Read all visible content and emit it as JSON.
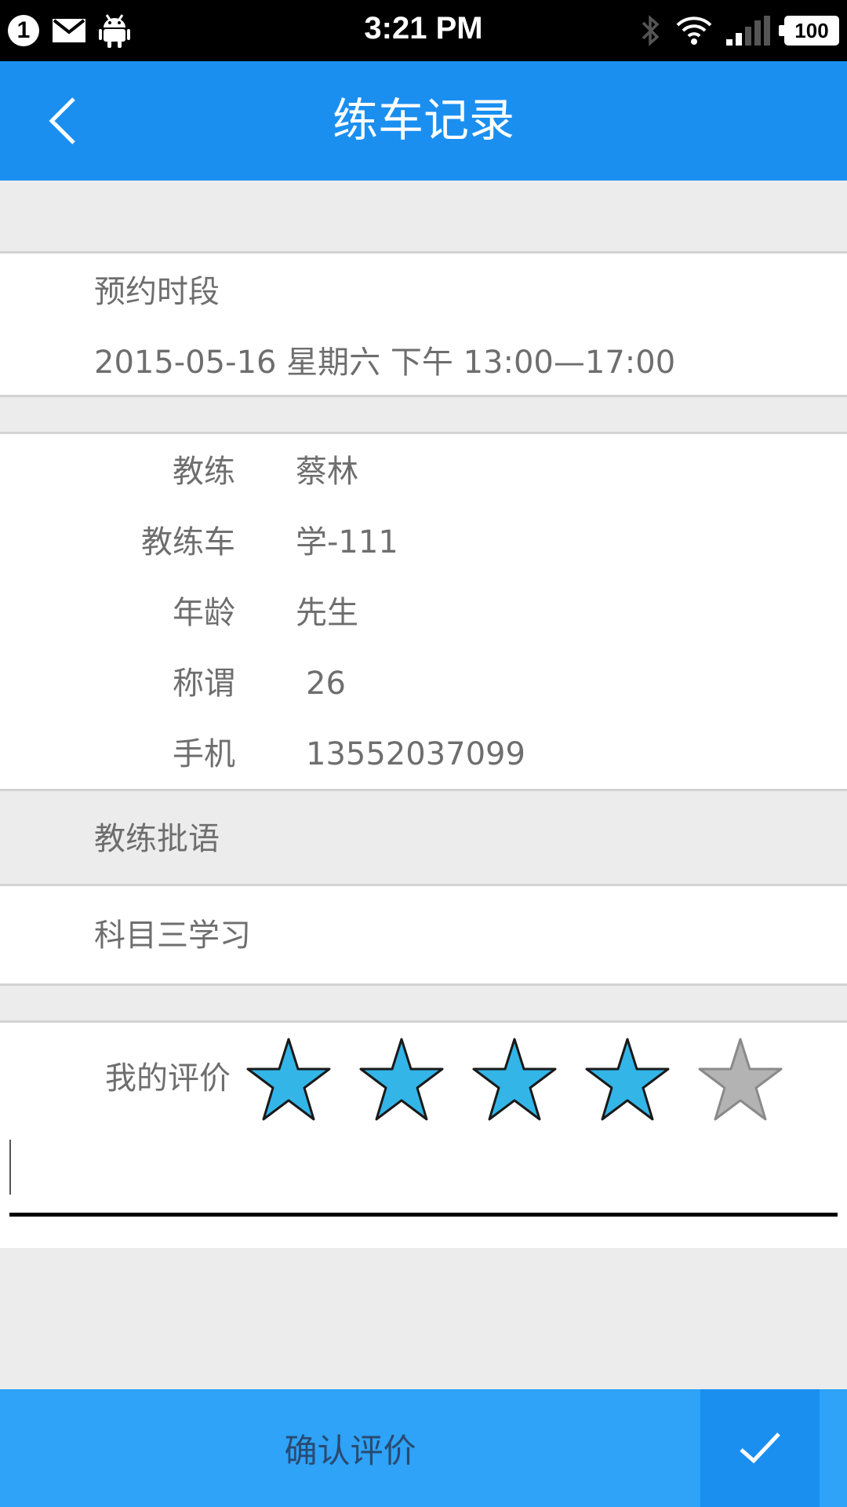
{
  "status_bar": {
    "notification_count": "1",
    "time": "3:21 PM",
    "battery": "100",
    "icons": [
      "notification-count-icon",
      "mail-icon",
      "android-icon",
      "bluetooth-icon",
      "wifi-icon",
      "signal-icon",
      "battery-icon"
    ]
  },
  "header": {
    "title": "练车记录",
    "back_icon": "chevron-left-icon"
  },
  "appointment": {
    "label": "预约时段",
    "value": "2015-05-16 星期六 下午 13:00—17:00"
  },
  "coach_info": [
    {
      "label": "教练",
      "value": "蔡林"
    },
    {
      "label": "教练车",
      "value": "学-111"
    },
    {
      "label": "年龄",
      "value": "先生"
    },
    {
      "label": "称谓",
      "value": "26"
    },
    {
      "label": "手机",
      "value": "13552037099"
    }
  ],
  "coach_comment": {
    "label": "教练批语",
    "value": "科目三学习"
  },
  "rating": {
    "label": "我的评价",
    "stars_filled": 4,
    "stars_total": 5,
    "filled_color": "#33b5e8",
    "empty_color": "#b3b3b3",
    "input_value": ""
  },
  "footer": {
    "confirm_label": "确认评价",
    "check_icon": "checkmark-icon"
  },
  "colors": {
    "primary": "#1a8ff0",
    "footer": "#2ea3f8",
    "background": "#ececec"
  }
}
